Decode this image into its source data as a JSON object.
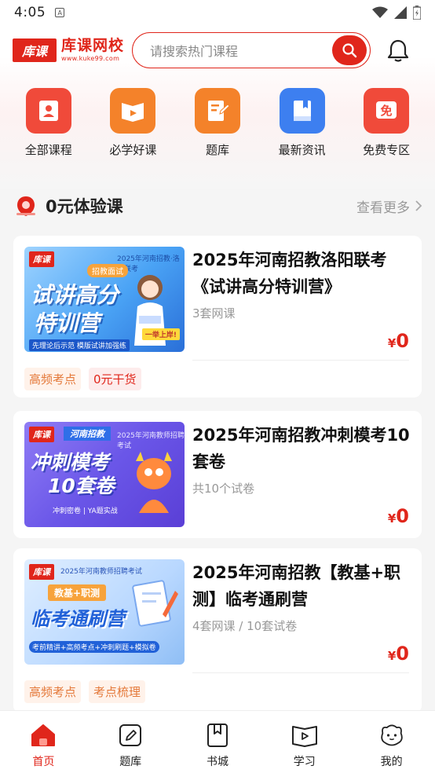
{
  "status_bar": {
    "time": "4:05",
    "sim_icon": "A"
  },
  "header": {
    "logo_box": "库课",
    "logo_name": "库课网校",
    "logo_url": "www.kuke99.com",
    "search_placeholder": "请搜索热门课程"
  },
  "categories": [
    {
      "label": "全部课程",
      "icon": "all-courses-icon",
      "color": "#f04a3a"
    },
    {
      "label": "必学好课",
      "icon": "must-learn-icon",
      "color": "#f4822a"
    },
    {
      "label": "题库",
      "icon": "question-bank-icon",
      "color": "#f4822a"
    },
    {
      "label": "最新资讯",
      "icon": "news-icon",
      "color": "#3d7ff0"
    },
    {
      "label": "免费专区",
      "icon": "free-zone-icon",
      "color": "#f04a3a"
    }
  ],
  "section": {
    "title": "0元体验课",
    "more": "查看更多"
  },
  "courses": [
    {
      "title": "2025年河南招教洛阳联考《试讲高分特训营》",
      "subtitle": "3套网课",
      "price_symbol": "¥",
      "price": "0",
      "chips": [
        "高频考点",
        "0元干货"
      ],
      "thumb": {
        "tag": "库课",
        "headline_1": "试讲高分",
        "headline_2": "特训营",
        "badge": "招教面试",
        "small_top": "2025年河南招教·洛阳联考",
        "small_bottom": "先理论后示范   模版试讲加强练",
        "stamp": "一举上岸!"
      }
    },
    {
      "title": "2025年河南招教冲刺模考10套卷",
      "subtitle": "共10个试卷",
      "price_symbol": "¥",
      "price": "0",
      "chips": [],
      "thumb": {
        "tag": "库课",
        "headline_1": "冲刺模考",
        "headline_2": "10套卷",
        "badge": "河南招教",
        "small_top": "2025年河南教师招聘考试",
        "small_bottom": "冲刺密卷 | YA题实战"
      }
    },
    {
      "title": "2025年河南招教【教基+职测】临考通刷营",
      "subtitle": "4套网课 / 10套试卷",
      "price_symbol": "¥",
      "price": "0",
      "chips": [
        "高频考点",
        "考点梳理"
      ],
      "thumb": {
        "tag": "库课",
        "headline_1": "临考通刷营",
        "badge": "教基+职测",
        "small_top": "2025年河南教师招聘考试",
        "small_bottom": "考前精讲+高频考点+冲刺刷题+模拟卷"
      }
    }
  ],
  "tabs": [
    {
      "label": "首页",
      "icon": "home-icon",
      "active": true
    },
    {
      "label": "题库",
      "icon": "question-bank-tab-icon",
      "active": false
    },
    {
      "label": "书城",
      "icon": "bookstore-icon",
      "active": false
    },
    {
      "label": "学习",
      "icon": "study-icon",
      "active": false
    },
    {
      "label": "我的",
      "icon": "profile-icon",
      "active": false
    }
  ],
  "colors": {
    "brand": "#e0261b",
    "chip_orange": "#e4793a"
  }
}
